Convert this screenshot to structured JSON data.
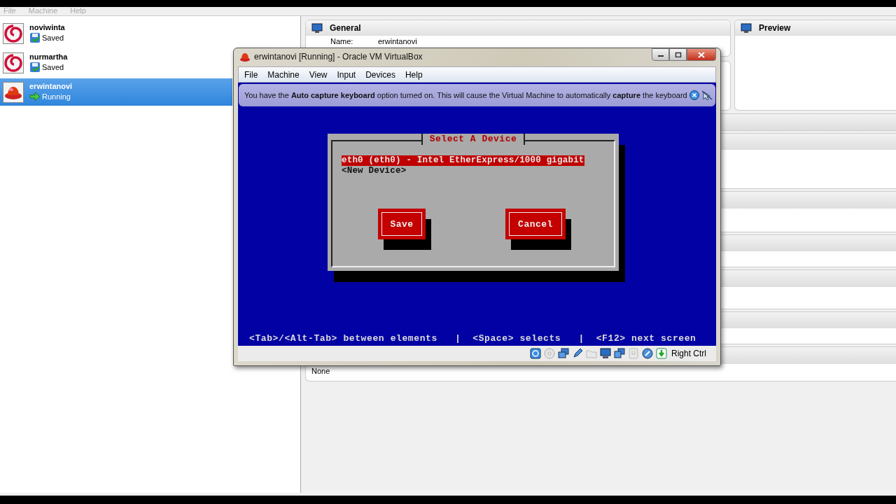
{
  "manager": {
    "menu": [
      "File",
      "Machine",
      "Help"
    ],
    "vms": [
      {
        "name": "noviwinta",
        "status": "Saved",
        "os_icon": {
          "kind": "debian"
        },
        "status_icon": {
          "kind": "saved"
        },
        "selected": false
      },
      {
        "name": "nurmartha",
        "status": "Saved",
        "os_icon": {
          "kind": "debian"
        },
        "status_icon": {
          "kind": "saved"
        },
        "selected": false
      },
      {
        "name": "erwintanovi",
        "status": "Running",
        "os_icon": {
          "kind": "redhat"
        },
        "status_icon": {
          "kind": "running"
        },
        "selected": true
      }
    ],
    "general": {
      "title": "General",
      "name_label": "Name:",
      "name_value": "erwintanovi"
    },
    "preview": {
      "title": "Preview"
    },
    "last_section": {
      "value": "None"
    }
  },
  "vm_window": {
    "title": "erwintanovi [Running] - Oracle VM VirtualBox",
    "menu": [
      "File",
      "Machine",
      "View",
      "Input",
      "Devices",
      "Help"
    ],
    "notice": "You have the **Auto capture keyboard** option turned on. This will cause the Virtual Machine to automatically **capture** the keyboard",
    "screen": {
      "dialog_title": "Select A Device",
      "items": [
        {
          "label": "eth0 (eth0) - Intel EtherExpress/1000 gigabit",
          "selected": true
        },
        {
          "label": "<New Device>",
          "selected": false
        }
      ],
      "buttons": [
        "Save",
        "Cancel"
      ],
      "hint": "<Tab>/<Alt-Tab> between elements   |  <Space> selects   |  <F12> next screen"
    },
    "status_bar": {
      "host_key": "Right Ctrl"
    }
  }
}
